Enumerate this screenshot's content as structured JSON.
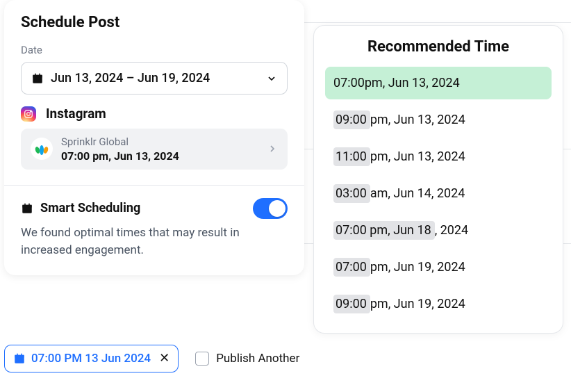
{
  "schedule": {
    "title": "Schedule Post",
    "date_label": "Date",
    "date_range": "Jun 13, 2024 – Jun 19, 2024",
    "platform": "Instagram",
    "account": {
      "name": "Sprinklr Global",
      "scheduled": "07:00 pm, Jun 13, 2024"
    },
    "smart": {
      "title": "Smart Scheduling",
      "desc": "We found optimal times that may result in increased engagement.",
      "enabled": true
    }
  },
  "recommended": {
    "title": "Recommended Time",
    "times": [
      {
        "prefix": "07:00",
        "rest": " pm, Jun 13, 2024",
        "selected": true
      },
      {
        "prefix": "09:00",
        "rest": " pm, Jun 13, 2024",
        "selected": false
      },
      {
        "prefix": "11:00",
        "rest": " pm, Jun 13, 2024",
        "selected": false
      },
      {
        "prefix": "03:00",
        "rest": " am, Jun 14, 2024",
        "selected": false
      },
      {
        "prefix": "07:00 pm, Jun 18",
        "rest": ", 2024",
        "selected": false
      },
      {
        "prefix": "07:00",
        "rest": " pm, Jun 19, 2024",
        "selected": false
      },
      {
        "prefix": "09:00",
        "rest": " pm, Jun 19, 2024",
        "selected": false
      }
    ]
  },
  "footer": {
    "chip_time": "07:00 PM 13 Jun 2024",
    "publish_another": "Publish Another"
  }
}
